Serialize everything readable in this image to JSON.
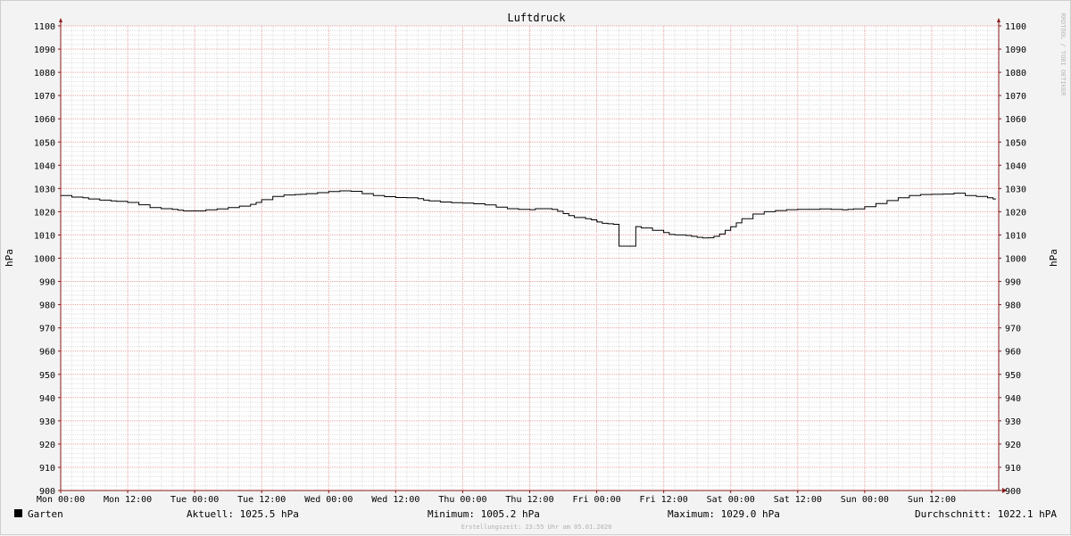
{
  "colors": {
    "background": "#f3f3f3",
    "plot_background": "#ffffff",
    "minor_grid": "#dedede",
    "major_grid": "#e8a0a0",
    "axis": "#8b1a1a",
    "series": "#000000"
  },
  "chart_data": {
    "type": "line",
    "title": "Luftdruck",
    "ylabel": "hPa",
    "ylim": [
      900,
      1100
    ],
    "grid": true,
    "y_ticks": [
      900,
      910,
      920,
      930,
      940,
      950,
      960,
      970,
      980,
      990,
      1000,
      1010,
      1020,
      1030,
      1040,
      1050,
      1060,
      1070,
      1080,
      1090,
      1100
    ],
    "x_ticks": [
      "Mon 00:00",
      "Mon 12:00",
      "Tue 00:00",
      "Tue 12:00",
      "Wed 00:00",
      "Wed 12:00",
      "Thu 00:00",
      "Thu 12:00",
      "Fri 00:00",
      "Fri 12:00",
      "Sat 00:00",
      "Sat 12:00",
      "Sun 00:00",
      "Sun 12:00"
    ],
    "x_range_hours": [
      0,
      168
    ],
    "series": [
      {
        "name": "Garten",
        "x_hours": [
          0,
          2,
          4,
          5,
          7,
          9,
          10,
          12,
          14,
          16,
          18,
          20,
          21,
          22,
          24,
          26,
          28,
          30,
          32,
          34,
          35,
          36,
          38,
          40,
          42,
          43,
          44,
          46,
          48,
          50,
          51,
          52,
          54,
          56,
          58,
          60,
          62,
          64,
          65,
          66,
          68,
          70,
          72,
          74,
          76,
          78,
          80,
          82,
          84,
          85,
          86,
          88,
          89,
          90,
          91,
          92,
          94,
          95,
          95.1,
          96,
          96.1,
          97,
          98,
          99,
          100,
          102,
          103,
          104,
          106,
          108,
          109,
          110,
          111,
          112,
          113,
          114,
          115,
          116,
          117,
          118,
          119,
          120,
          121,
          122,
          124,
          126,
          128,
          130,
          132,
          133,
          134,
          136,
          138,
          140,
          141,
          142,
          144,
          146,
          148,
          150,
          152,
          154,
          156,
          158,
          160,
          162,
          164,
          166,
          167
        ],
        "values": [
          1027.0,
          1026.3,
          1026.0,
          1025.5,
          1025.0,
          1024.7,
          1024.5,
          1024.0,
          1023.0,
          1021.8,
          1021.3,
          1021.0,
          1020.7,
          1020.4,
          1020.4,
          1020.8,
          1021.2,
          1021.8,
          1022.4,
          1023.2,
          1024.0,
          1025.2,
          1026.6,
          1027.2,
          1027.4,
          1027.5,
          1027.8,
          1028.2,
          1028.7,
          1029.0,
          1029.0,
          1028.8,
          1027.8,
          1027.0,
          1026.5,
          1026.1,
          1026.0,
          1025.6,
          1025.0,
          1024.7,
          1024.2,
          1023.9,
          1023.7,
          1023.4,
          1022.9,
          1022.0,
          1021.3,
          1021.0,
          1020.9,
          1021.3,
          1021.3,
          1021.0,
          1020.2,
          1019.2,
          1018.3,
          1017.5,
          1017.0,
          1016.7,
          1016.5,
          1016.0,
          1015.6,
          1015.0,
          1014.8,
          1014.6,
          1005.2,
          1005.2,
          1013.6,
          1013.0,
          1012.0,
          1011.0,
          1010.2,
          1010.0,
          1010.0,
          1009.8,
          1009.4,
          1009.0,
          1008.7,
          1008.8,
          1009.4,
          1010.4,
          1012.0,
          1013.5,
          1015.2,
          1017.0,
          1019.0,
          1020.0,
          1020.5,
          1020.9,
          1021.0,
          1021.0,
          1021.0,
          1021.2,
          1021.0,
          1020.8,
          1021.0,
          1021.2,
          1022.2,
          1023.5,
          1024.8,
          1026.0,
          1027.0,
          1027.4,
          1027.5,
          1027.6,
          1028.0,
          1027.0,
          1026.6,
          1026.0,
          1025.5
        ]
      }
    ]
  },
  "watermark": "RRDTOOL / TOBI OETIKER",
  "footer": {
    "legend_name": "Garten",
    "aktuell": "Aktuell: 1025.5 hPa",
    "minimum": "Minimum: 1005.2 hPa",
    "maximum": "Maximum: 1029.0 hPa",
    "durchschnitt": "Durchschnitt: 1022.1 hPA",
    "erstellt": "Erstellungszeit: 23:55 Uhr am 05.01.2020"
  }
}
